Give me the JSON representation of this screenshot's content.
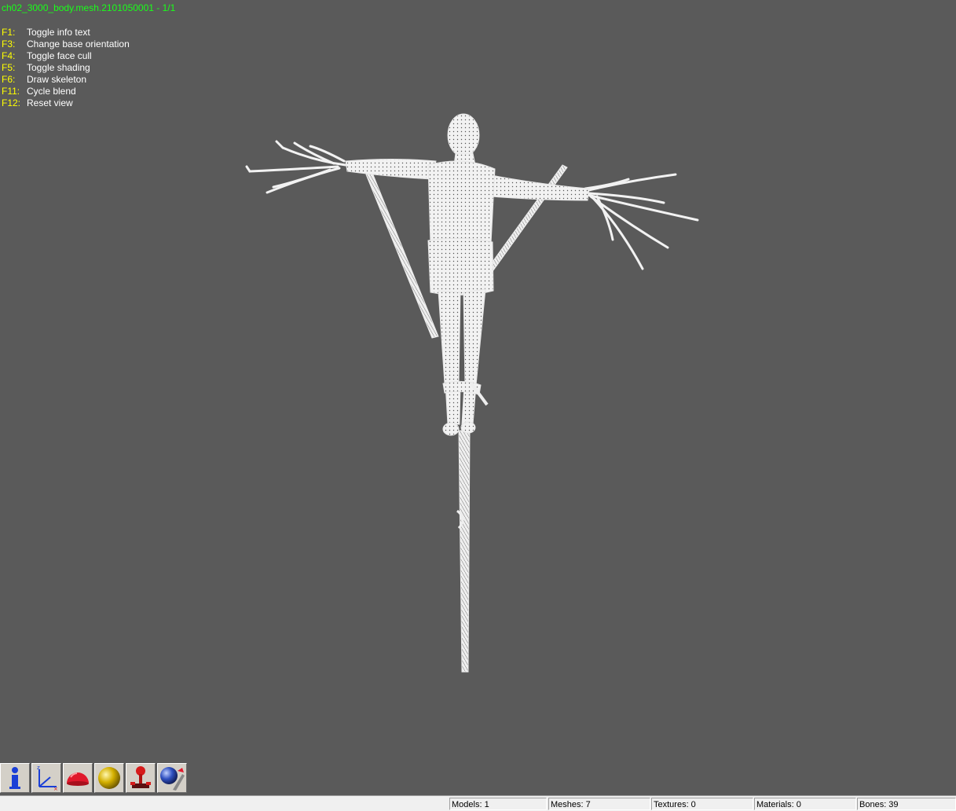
{
  "viewer": {
    "title": "ch02_3000_body.mesh.2101050001 - 1/1",
    "help": [
      {
        "key": "F1:",
        "desc": "Toggle info text"
      },
      {
        "key": "F3:",
        "desc": "Change base orientation"
      },
      {
        "key": "F4:",
        "desc": "Toggle face cull"
      },
      {
        "key": "F5:",
        "desc": "Toggle shading"
      },
      {
        "key": "F6:",
        "desc": "Draw skeleton"
      },
      {
        "key": "F11:",
        "desc": "Cycle blend"
      },
      {
        "key": "F12:",
        "desc": "Reset view"
      }
    ]
  },
  "toolbar": {
    "buttons": [
      {
        "name": "info-icon"
      },
      {
        "name": "axes-icon",
        "axis_label": "z"
      },
      {
        "name": "hemisphere-icon"
      },
      {
        "name": "sphere-icon"
      },
      {
        "name": "joystick-icon"
      },
      {
        "name": "globe-wand-icon"
      }
    ]
  },
  "status": {
    "models": "Models: 1",
    "meshes": "Meshes: 7",
    "textures": "Textures: 0",
    "materials": "Materials: 0",
    "bones": "Bones: 39"
  },
  "colors": {
    "background": "#5a5a5a",
    "title": "#19ff19",
    "help_key": "#ffff00",
    "help_text": "#ffffff",
    "mesh": "#f2f2f2"
  }
}
